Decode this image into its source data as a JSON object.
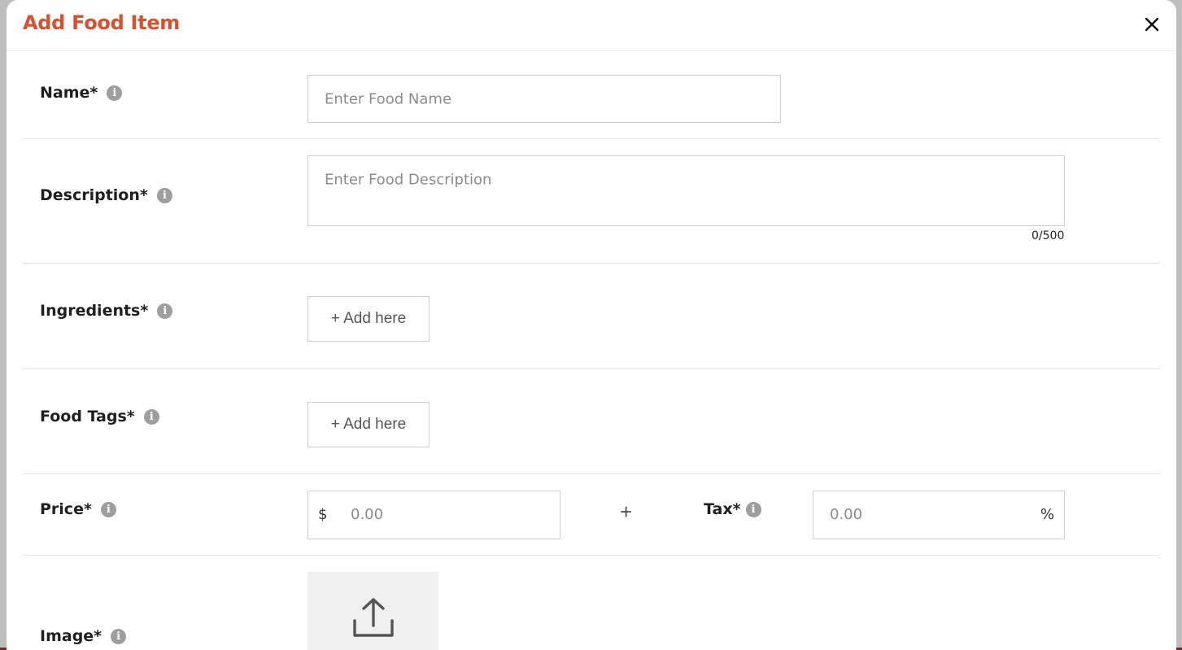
{
  "modal": {
    "title": "Add Food Item"
  },
  "fields": {
    "name": {
      "label": "Name*",
      "placeholder": "Enter Food Name"
    },
    "description": {
      "label": "Description*",
      "placeholder": "Enter Food Description",
      "counter": "0/500"
    },
    "ingredients": {
      "label": "Ingredients*",
      "button": "+ Add here"
    },
    "food_tags": {
      "label": "Food Tags*",
      "button": "+ Add here"
    },
    "price": {
      "label": "Price*",
      "currency": "$",
      "placeholder": "0.00"
    },
    "plus": "+",
    "tax": {
      "label": "Tax*",
      "placeholder": "0.00",
      "unit": "%"
    },
    "image": {
      "label": "Image*"
    }
  },
  "info_icon": "i",
  "colors": {
    "accent": "#d9502c",
    "info": "#9e9e9e",
    "border": "#cfcfcf"
  },
  "icons": [
    "close-icon",
    "info-icon",
    "upload-icon"
  ]
}
